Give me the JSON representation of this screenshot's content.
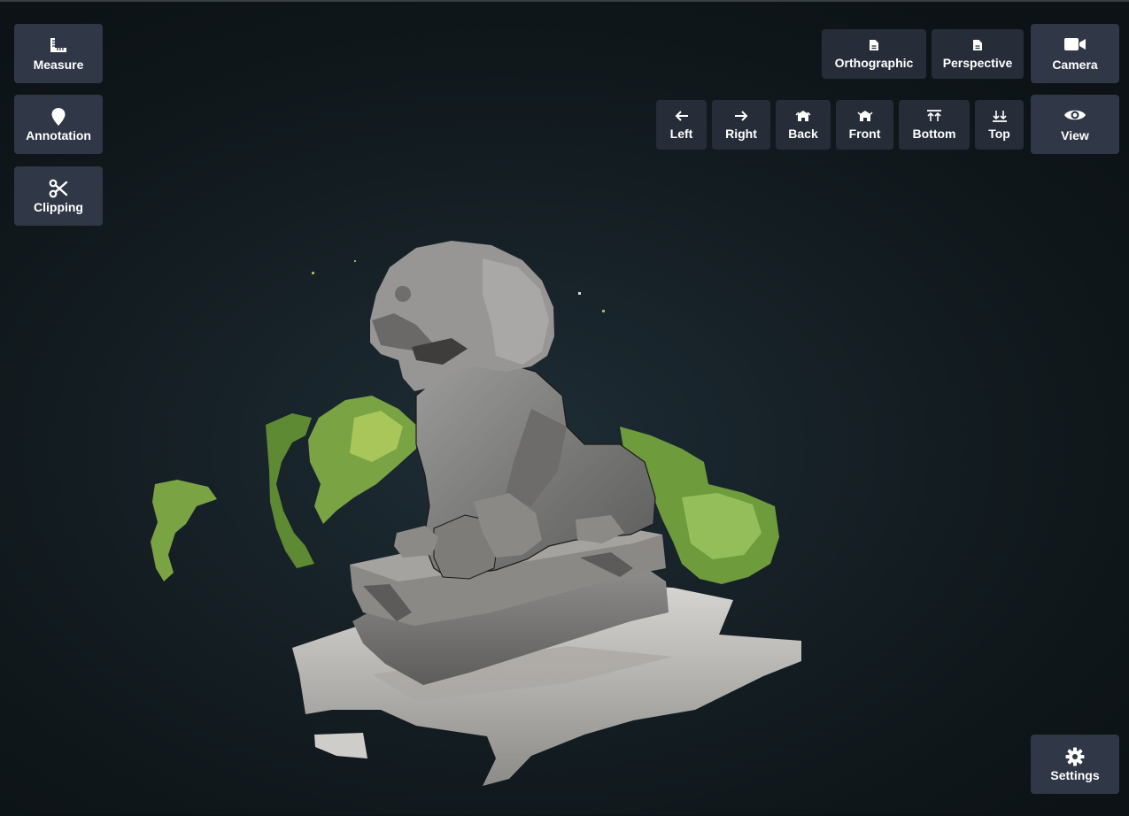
{
  "toolbar_left": {
    "measure_label": "Measure",
    "annotation_label": "Annotation",
    "clipping_label": "Clipping"
  },
  "projection": {
    "orthographic_label": "Orthographic",
    "perspective_label": "Perspective"
  },
  "views": {
    "left_label": "Left",
    "right_label": "Right",
    "back_label": "Back",
    "front_label": "Front",
    "bottom_label": "Bottom",
    "top_label": "Top"
  },
  "toolbar_right": {
    "camera_label": "Camera",
    "view_label": "View",
    "settings_label": "Settings"
  },
  "icons": {
    "measure": "ruler-icon",
    "annotation": "map-pin-icon",
    "clipping": "scissors-icon",
    "orthographic": "file-icon",
    "perspective": "file-icon",
    "left": "arrow-left-icon",
    "right": "arrow-right-icon",
    "back": "view-back-icon",
    "front": "view-front-icon",
    "bottom": "arrows-up-icon",
    "top": "arrows-down-icon",
    "camera": "video-camera-icon",
    "view": "eye-icon",
    "settings": "gear-icon"
  },
  "colors": {
    "button_bg": "#303746",
    "background": "#131c21",
    "text": "#ffffff"
  }
}
